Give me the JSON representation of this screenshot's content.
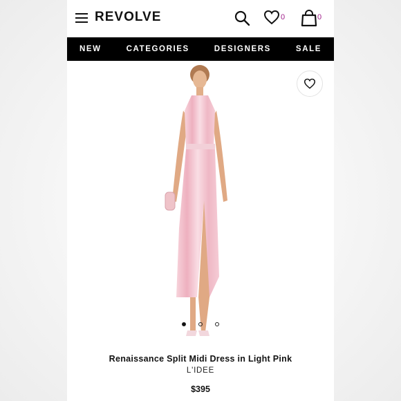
{
  "header": {
    "logo": "REVOLVE",
    "wishlist_count": "0",
    "bag_count": "0"
  },
  "nav": {
    "items": [
      "NEW",
      "CATEGORIES",
      "DESIGNERS",
      "SALE"
    ]
  },
  "product": {
    "title": "Renaissance Split Midi Dress in Light Pink",
    "brand": "L'IDEE",
    "price": "$395",
    "image_count": 3,
    "active_image": 1
  },
  "colors": {
    "nav_bg": "#000000",
    "accent_count": "#a0208a",
    "dress": "#f4c6d0"
  },
  "icons": [
    "menu-icon",
    "search-icon",
    "heart-icon",
    "bag-icon"
  ]
}
